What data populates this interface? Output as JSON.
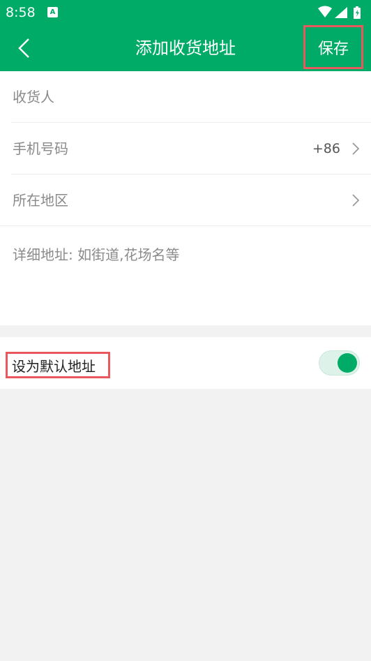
{
  "colors": {
    "brand_green": "#00ab67",
    "highlight_red": "#e8585c",
    "background": "#f2f2f2"
  },
  "status_bar": {
    "time": "8:58",
    "notification_icon": "A",
    "icons": [
      "wifi-icon",
      "signal-icon",
      "battery-icon"
    ]
  },
  "nav": {
    "back_icon": "chevron-left-icon",
    "title": "添加收货地址",
    "save_label": "保存"
  },
  "form": {
    "recipient_placeholder": "收货人",
    "phone_placeholder": "手机号码",
    "country_code": "+86",
    "region_label": "所在地区",
    "detail_placeholder": "详细地址: 如街道,花场名等"
  },
  "default_address": {
    "label": "设为默认地址",
    "enabled": true
  }
}
